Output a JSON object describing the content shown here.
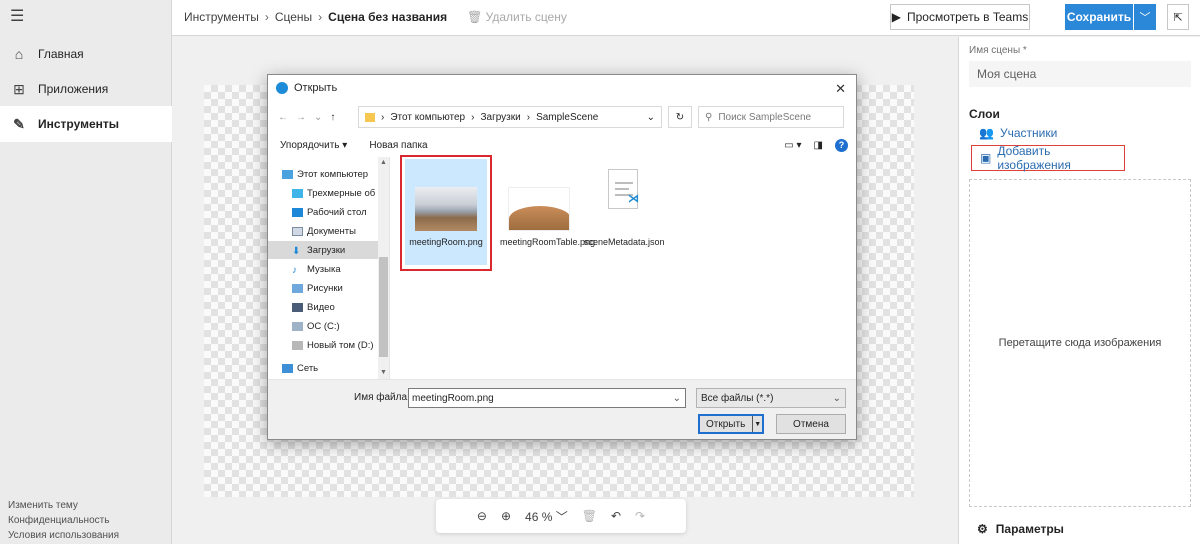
{
  "nav": {
    "items": [
      {
        "label": "Главная",
        "icon": "home-icon"
      },
      {
        "label": "Приложения",
        "icon": "apps-icon"
      },
      {
        "label": "Инструменты",
        "icon": "pen-icon"
      }
    ],
    "footer": [
      "Изменить тему",
      "Конфиденциальность",
      "Условия использования"
    ]
  },
  "breadcrumb": {
    "items": [
      "Инструменты",
      "Сцены"
    ],
    "current": "Сцена без названия",
    "delete_label": "Удалить сцену"
  },
  "toolbar": {
    "preview_label": "Просмотреть в Teams",
    "save_label": "Сохранить"
  },
  "zoom": {
    "value": "46 %"
  },
  "panel": {
    "name_label": "Имя сцены *",
    "name_value": "Моя сцена",
    "layers_title": "Слои",
    "participants": "Участники",
    "add_images": "Добавить изображения",
    "drop_text": "Перетащите сюда изображения",
    "params": "Параметры"
  },
  "dialog": {
    "title": "Открыть",
    "path": [
      "Этот компьютер",
      "Загрузки",
      "SampleScene"
    ],
    "search_placeholder": "Поиск SampleScene",
    "organize": "Упорядочить ▾",
    "new_folder": "Новая папка",
    "tree": [
      "Этот компьютер",
      "Трехмерные об",
      "Рабочий стол",
      "Документы",
      "Загрузки",
      "Музыка",
      "Рисунки",
      "Видео",
      "ОС (C:)",
      "Новый том (D:)",
      "Сеть"
    ],
    "files": [
      "meetingRoom.png",
      "meetingRoomTable.png",
      "sceneMetadata.json"
    ],
    "filename_label": "Имя файла:",
    "filename_value": "meetingRoom.png",
    "filetype": "Все файлы (*.*)",
    "open_label": "Открыть",
    "cancel_label": "Отмена"
  },
  "colors": {
    "accent": "#2b88d8",
    "highlight": "#d9282f"
  }
}
